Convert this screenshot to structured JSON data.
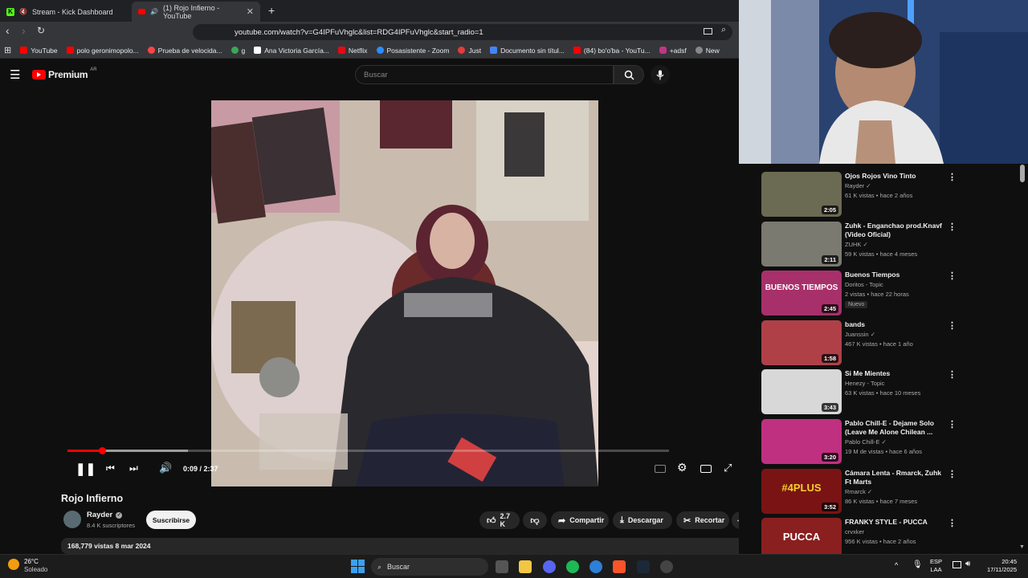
{
  "browser": {
    "tabs": [
      {
        "label": "Stream - Kick Dashboard"
      },
      {
        "label": "(1) Rojo Infierno - YouTube"
      }
    ],
    "url": "youtube.com/watch?v=G4IPFuVhglc&list=RDG4IPFuVhglc&start_radio=1",
    "bookmarks": [
      "YouTube",
      "polo geronimopolo...",
      "Prueba de velocida...",
      "g",
      "Ana Victoria García...",
      "Netflix",
      "Posasistente - Zoom",
      "Just",
      "Documento sin títul...",
      "(84) bo'o'ba - YouTu...",
      "+adsf",
      "New"
    ]
  },
  "youtube": {
    "brand": "Premium",
    "region": "AR",
    "search_placeholder": "Buscar"
  },
  "player": {
    "time": "0:09 / 2:37",
    "progress": 0.057
  },
  "video": {
    "title": "Rojo Infierno",
    "channel": "Rayder",
    "subscribers": "8.4 K suscriptores",
    "subscribe_label": "Suscribirse",
    "likes": "2.7 K",
    "share_label": "Compartir",
    "download_label": "Descargar",
    "clip_label": "Recortar",
    "views_date": "168,779 vistas  8 mar 2024"
  },
  "recommendations": [
    {
      "title": "Ojos Rojos Vino Tinto",
      "channel": "Rayder",
      "verified": true,
      "meta": "61 K vistas • hace 2 años",
      "duration": "2:05",
      "color": "#6b6a52"
    },
    {
      "title": "Zuhk - Enganchao prod.Knavf (Video Oficial)",
      "channel": "ZUHK",
      "verified": true,
      "meta": "59 K vistas • hace 4 meses",
      "duration": "2:11",
      "color": "#7a7a70"
    },
    {
      "title": "Buenos Tiempos",
      "channel": "Doritos - Topic",
      "verified": false,
      "meta": "2 vistas • hace 22 horas",
      "badge": "Nuevo",
      "duration": "2:45",
      "color": "#a8306a"
    },
    {
      "title": "bands",
      "channel": "Juanssin",
      "verified": true,
      "meta": "467 K vistas • hace 1 año",
      "duration": "1:58",
      "color": "#b04048"
    },
    {
      "title": "Si Me Mientes",
      "channel": "Henezy - Topic",
      "verified": false,
      "meta": "63 K vistas • hace 10 meses",
      "duration": "3:43",
      "color": "#d8d8d8"
    },
    {
      "title": "Pablo Chill-E - Dejame Solo (Leave Me Alone Chilean ...",
      "channel": "Pablo Chill-E",
      "verified": true,
      "meta": "19 M de vistas • hace 6 años",
      "duration": "3:20",
      "color": "#c03080"
    },
    {
      "title": "Cámara Lenta - Rmarck, Zuhk Ft Marts",
      "channel": "Rmarck",
      "verified": true,
      "meta": "86 K vistas • hace 7 meses",
      "duration": "3:52",
      "color": "#7a1414"
    },
    {
      "title": "FRANKY STYLE - PUCCA",
      "channel": "crvxker",
      "verified": false,
      "meta": "956 K vistas • hace 2 años",
      "duration": "",
      "color": "#8a1f1f"
    }
  ],
  "thumb_text": {
    "buenos": "BUENOS TIEMPOS",
    "camara": "#4PLUS",
    "pucca": "PUCCA"
  },
  "taskbar": {
    "weather_temp": "26°C",
    "weather_desc": "Soleado",
    "search_placeholder": "Buscar",
    "lang1": "ESP",
    "lang2": "LAA",
    "time": "20:45",
    "date": "17/11/2025"
  }
}
